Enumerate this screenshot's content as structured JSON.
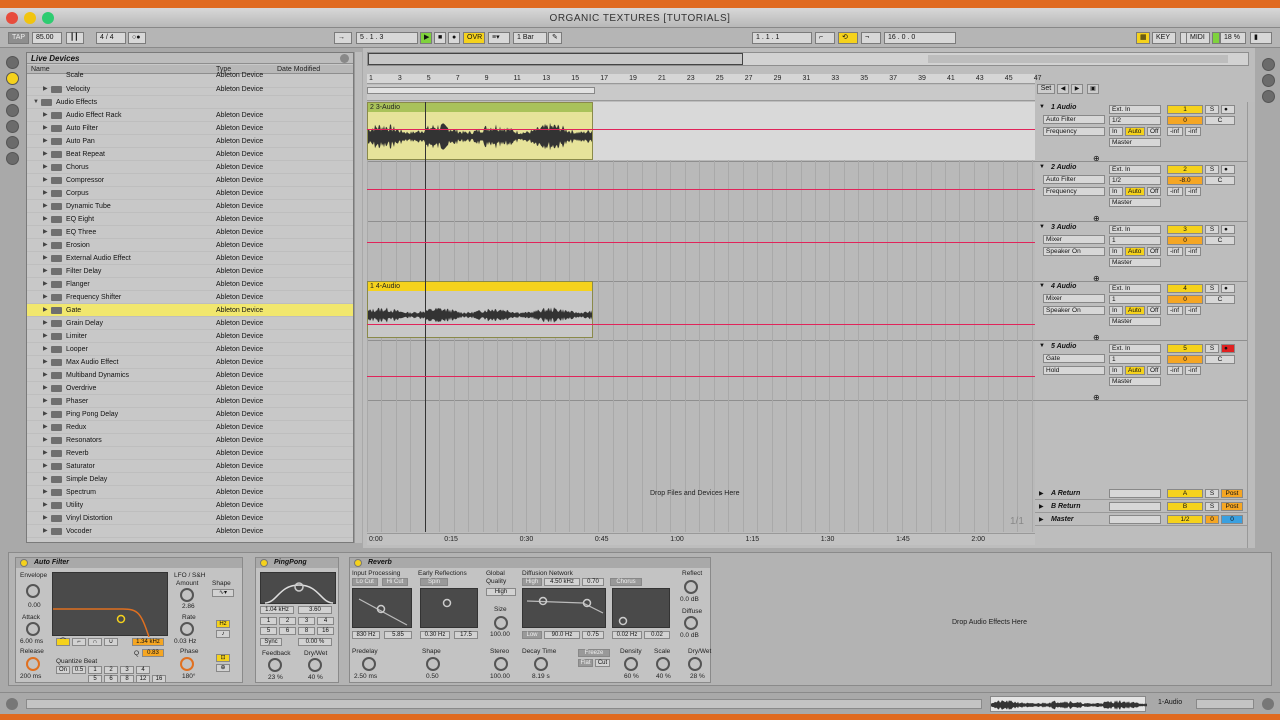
{
  "window": {
    "title": "ORGANIC TEXTURES  [TUTORIALS]"
  },
  "transport": {
    "tap": "TAP",
    "tempo": "85.00",
    "meter": "4 / 4",
    "metronome": "○●",
    "arrangement_position": "5 .   1 .   3",
    "ovr": "OVR",
    "quantize": "1 Bar",
    "loop_start": "1 .   1 .   1",
    "loop_length": "16 .   0 .   0",
    "key": "KEY",
    "midi": "MIDI",
    "cpu": "18 %"
  },
  "browser": {
    "title": "Live Devices",
    "headers": {
      "name": "Name",
      "type": "Type",
      "date": "Date Modified"
    },
    "partial_top": "Scale",
    "group": "Audio Effects",
    "group_type": "Ableton Device",
    "items": [
      {
        "name": "Velocity",
        "type": "Ableton Device"
      },
      {
        "name": "Audio Effect Rack",
        "type": "Ableton Device"
      },
      {
        "name": "Auto Filter",
        "type": "Ableton Device"
      },
      {
        "name": "Auto Pan",
        "type": "Ableton Device"
      },
      {
        "name": "Beat Repeat",
        "type": "Ableton Device"
      },
      {
        "name": "Chorus",
        "type": "Ableton Device"
      },
      {
        "name": "Compressor",
        "type": "Ableton Device"
      },
      {
        "name": "Corpus",
        "type": "Ableton Device"
      },
      {
        "name": "Dynamic Tube",
        "type": "Ableton Device"
      },
      {
        "name": "EQ Eight",
        "type": "Ableton Device"
      },
      {
        "name": "EQ Three",
        "type": "Ableton Device"
      },
      {
        "name": "Erosion",
        "type": "Ableton Device"
      },
      {
        "name": "External Audio Effect",
        "type": "Ableton Device"
      },
      {
        "name": "Filter Delay",
        "type": "Ableton Device"
      },
      {
        "name": "Flanger",
        "type": "Ableton Device"
      },
      {
        "name": "Frequency Shifter",
        "type": "Ableton Device"
      },
      {
        "name": "Gate",
        "type": "Ableton Device"
      },
      {
        "name": "Grain Delay",
        "type": "Ableton Device"
      },
      {
        "name": "Limiter",
        "type": "Ableton Device"
      },
      {
        "name": "Looper",
        "type": "Ableton Device"
      },
      {
        "name": "Max Audio Effect",
        "type": "Ableton Device"
      },
      {
        "name": "Multiband Dynamics",
        "type": "Ableton Device"
      },
      {
        "name": "Overdrive",
        "type": "Ableton Device"
      },
      {
        "name": "Phaser",
        "type": "Ableton Device"
      },
      {
        "name": "Ping Pong Delay",
        "type": "Ableton Device"
      },
      {
        "name": "Redux",
        "type": "Ableton Device"
      },
      {
        "name": "Resonators",
        "type": "Ableton Device"
      },
      {
        "name": "Reverb",
        "type": "Ableton Device"
      },
      {
        "name": "Saturator",
        "type": "Ableton Device"
      },
      {
        "name": "Simple Delay",
        "type": "Ableton Device"
      },
      {
        "name": "Spectrum",
        "type": "Ableton Device"
      },
      {
        "name": "Utility",
        "type": "Ableton Device"
      },
      {
        "name": "Vinyl Distortion",
        "type": "Ableton Device"
      },
      {
        "name": "Vocoder",
        "type": "Ableton Device"
      }
    ],
    "selected": "Gate"
  },
  "arrangement": {
    "bar_numbers": [
      "1",
      "3",
      "5",
      "7",
      "9",
      "11",
      "13",
      "15",
      "17",
      "19",
      "21",
      "23",
      "25",
      "27",
      "29",
      "31",
      "33",
      "35",
      "37",
      "39",
      "41",
      "43",
      "45",
      "47"
    ],
    "time_labels": [
      "0:00",
      "0:15",
      "0:30",
      "0:45",
      "1:00",
      "1:15",
      "1:30",
      "1:45",
      "2:00"
    ],
    "clip1": "2 3-Audio",
    "clip2": "1 4-Audio",
    "drop_files": "Drop Files and Devices Here",
    "page": "1/1",
    "set_btn": "Set"
  },
  "tracks": [
    {
      "name": "1 Audio",
      "device": "Auto Filter",
      "param": "Frequency",
      "input": "Ext. In",
      "channel": "1/2",
      "num": "1",
      "vol": "0",
      "pan": "C",
      "out": "Master",
      "mon": "In",
      "auto": "Auto",
      "off": "Off",
      "inf1": "-inf",
      "inf2": "-inf",
      "armed": false
    },
    {
      "name": "2 Audio",
      "device": "Auto Filter",
      "param": "Frequency",
      "input": "Ext. In",
      "channel": "1/2",
      "num": "2",
      "vol": "-8.0",
      "pan": "C",
      "out": "Master",
      "mon": "In",
      "auto": "Auto",
      "off": "Off",
      "inf1": "-inf",
      "inf2": "-inf",
      "armed": false
    },
    {
      "name": "3 Audio",
      "device": "Mixer",
      "param": "Speaker On",
      "input": "Ext. In",
      "channel": "1",
      "num": "3",
      "vol": "0",
      "pan": "C",
      "out": "Master",
      "mon": "In",
      "auto": "Auto",
      "off": "Off",
      "inf1": "-inf",
      "inf2": "-inf",
      "armed": false
    },
    {
      "name": "4 Audio",
      "device": "Mixer",
      "param": "Speaker On",
      "input": "Ext. In",
      "channel": "1",
      "num": "4",
      "vol": "0",
      "pan": "C",
      "out": "Master",
      "mon": "In",
      "auto": "Auto",
      "off": "Off",
      "inf1": "-inf",
      "inf2": "-inf",
      "armed": false
    },
    {
      "name": "5 Audio",
      "device": "Gate",
      "param": "Hold",
      "input": "Ext. In",
      "channel": "1",
      "num": "5",
      "vol": "0",
      "pan": "C",
      "out": "Master",
      "mon": "In",
      "auto": "Auto",
      "off": "Off",
      "inf1": "-inf",
      "inf2": "-inf",
      "armed": true
    }
  ],
  "returns": [
    {
      "name": "A Return",
      "letter": "A",
      "solo": "S",
      "post": "Post"
    },
    {
      "name": "B Return",
      "letter": "B",
      "solo": "S",
      "post": "Post"
    },
    {
      "name": "Master",
      "letter": "1/2",
      "solo": "0",
      "post": "0"
    }
  ],
  "solo_label": "S",
  "devices": {
    "auto_filter": {
      "title": "Auto Filter",
      "envelope": "Envelope",
      "env_val": "0.00",
      "attack": "Attack",
      "attack_val": "6.00 ms",
      "release": "Release",
      "release_val": "200 ms",
      "lfo": "LFO / S&H",
      "amount": "Amount",
      "amount_val": "2.86",
      "shape": "Shape",
      "rate": "Rate",
      "rate_val": "0.03 Hz",
      "phase": "Phase",
      "phase_val": "180°",
      "freq_val": "1.34 kHz",
      "q": "Q",
      "q_val": "0.83",
      "quantize_beat": "Quantize Beat",
      "q_btns": [
        "On",
        "0.5",
        "1",
        "2",
        "3",
        "4",
        "5",
        "6",
        "8",
        "12",
        "16"
      ],
      "hz": "Hz",
      "sync": "♪"
    },
    "pingpong": {
      "title": "PingPong",
      "freq": "1.04 kHz",
      "width": "3.60",
      "btns": [
        "1",
        "2",
        "3",
        "4",
        "5",
        "6",
        "8",
        "16"
      ],
      "sync": "Sync",
      "pct": "0.00 %",
      "feedback": "Feedback",
      "feedback_val": "23 %",
      "drywet": "Dry/Wet",
      "drywet_val": "40 %"
    },
    "reverb": {
      "title": "Reverb",
      "input": "Input Processing",
      "lo_cut": "Lo Cut",
      "hi_cut": "Hi Cut",
      "in_freq": "830 Hz",
      "in_width": "5.85",
      "early": "Early Reflections",
      "spin": "Spin",
      "er_freq": "0.30 Hz",
      "er_amt": "17.5",
      "global": "Global",
      "quality": "Quality",
      "quality_val": "High",
      "size": "Size",
      "size_val": "100.00",
      "diffusion": "Diffusion Network",
      "high": "High",
      "hi_freq": "4.50 kHz",
      "hi_val": "0.70",
      "chorus": "Chorus",
      "low": "Low",
      "lo_freq": "90.0 Hz",
      "lo_val": "0.75",
      "ch_freq": "0.02 Hz",
      "ch_amt": "0.02",
      "reflect": "Reflect",
      "reflect_val": "0.0 dB",
      "diffuse": "Diffuse",
      "diffuse_val": "0.0 dB",
      "predelay": "Predelay",
      "predelay_val": "2.50 ms",
      "shape": "Shape",
      "shape_val": "0.50",
      "stereo": "Stereo",
      "stereo_val": "100.00",
      "decay": "Decay Time",
      "decay_val": "8.19 s",
      "freeze": "Freeze",
      "flat": "Flat",
      "cut": "Cut",
      "density": "Density",
      "density_val": "60 %",
      "scale": "Scale",
      "scale_val": "40 %",
      "drywet": "Dry/Wet",
      "drywet_val": "28 %"
    },
    "drop_effects": "Drop Audio Effects Here"
  },
  "status": {
    "track": "1-Audio"
  }
}
